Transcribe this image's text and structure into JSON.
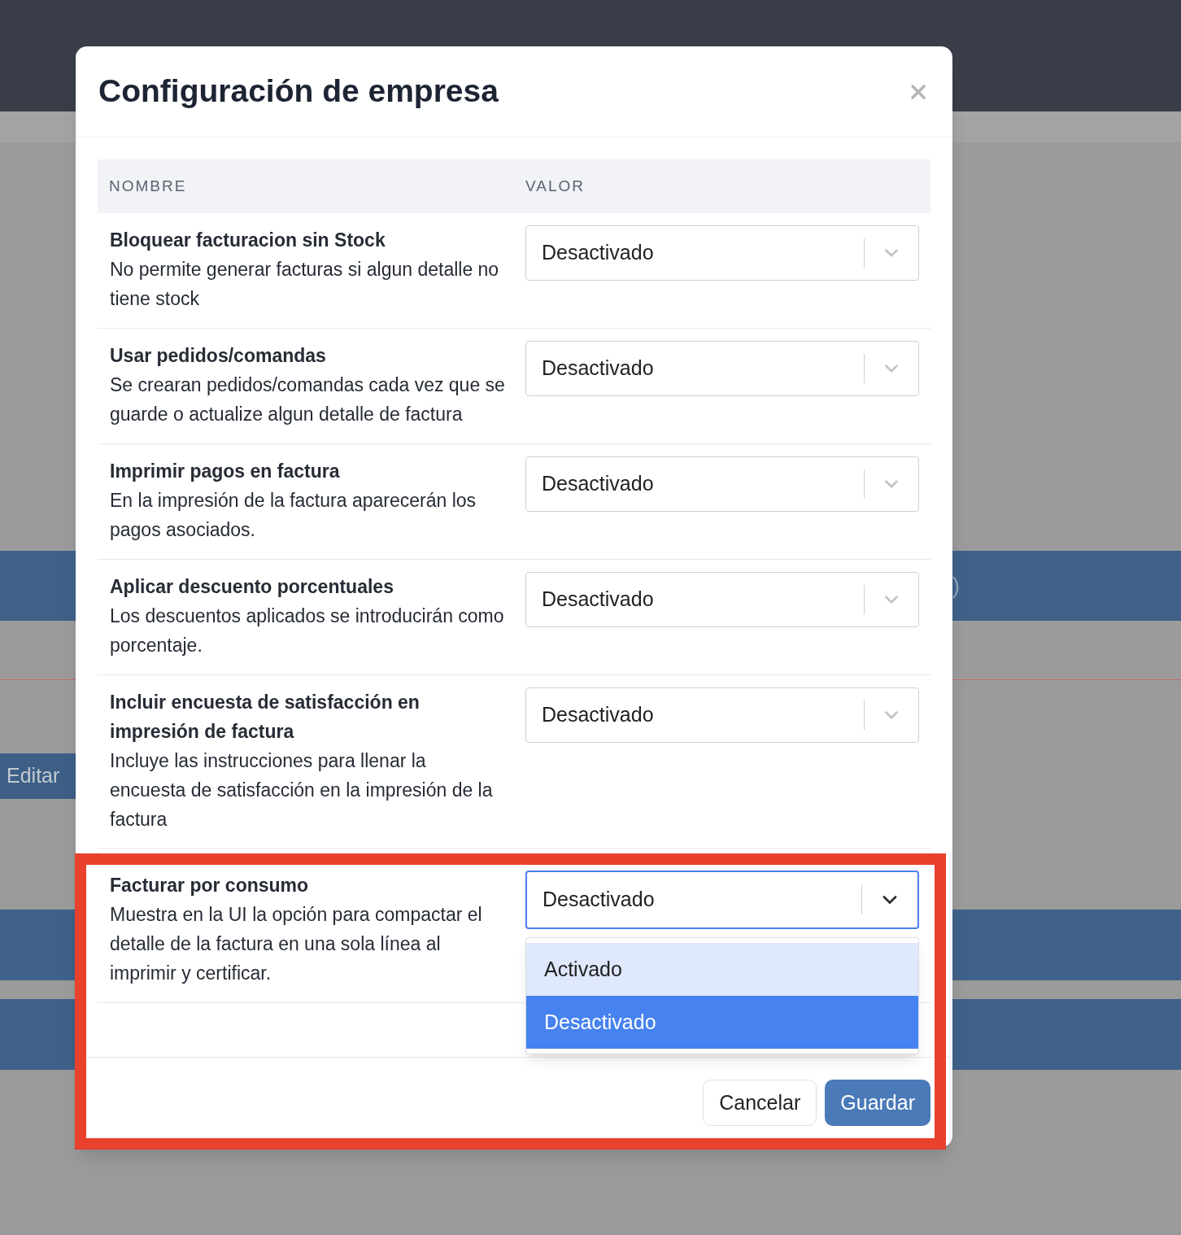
{
  "background": {
    "side_button": "Editar",
    "fragment": ")"
  },
  "modal": {
    "title": "Configuración de empresa",
    "table": {
      "columns": [
        "NOMBRE",
        "VALOR"
      ],
      "rows": [
        {
          "name": "Bloquear facturacion sin Stock",
          "description": "No permite generar facturas si algun detalle no tiene stock",
          "value": "Desactivado",
          "expanded": false
        },
        {
          "name": "Usar pedidos/comandas",
          "description": "Se crearan pedidos/comandas cada vez que se guarde o actualize algun detalle de factura",
          "value": "Desactivado",
          "expanded": false
        },
        {
          "name": "Imprimir pagos en factura",
          "description": "En la impresión de la factura aparecerán los pagos asociados.",
          "value": "Desactivado",
          "expanded": false
        },
        {
          "name": "Aplicar descuento porcentuales",
          "description": "Los descuentos aplicados se introducirán como porcentaje.",
          "value": "Desactivado",
          "expanded": false
        },
        {
          "name": "Incluir encuesta de satisfacción en impresión de factura",
          "description": "Incluye las instrucciones para llenar la encuesta de satisfacción en la impresión de la factura",
          "value": "Desactivado",
          "expanded": false
        },
        {
          "name": "Facturar por consumo",
          "description": "Muestra en la UI la opción para compactar el detalle de la factura en una sola línea al imprimir y certificar.",
          "value": "Desactivado",
          "expanded": true,
          "options": [
            {
              "label": "Activado",
              "selected": false,
              "hovered": true
            },
            {
              "label": "Desactivado",
              "selected": true,
              "hovered": false
            }
          ]
        }
      ]
    },
    "buttons": [
      {
        "label": "Cancelar",
        "kind": "secondary"
      },
      {
        "label": "Guardar",
        "kind": "primary"
      }
    ]
  },
  "annotation_box": true
}
